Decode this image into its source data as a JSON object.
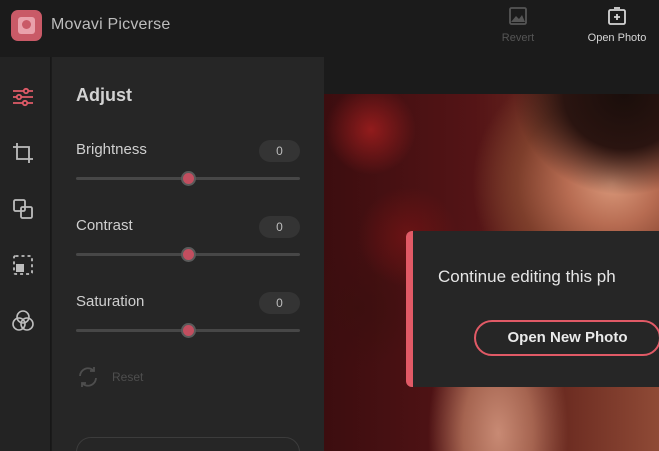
{
  "app": {
    "title": "Movavi Picverse"
  },
  "toolbar": {
    "revert_label": "Revert",
    "open_photo_label": "Open Photo"
  },
  "sidebar": {
    "tools": [
      {
        "name": "adjust",
        "icon": "sliders-icon",
        "active": true
      },
      {
        "name": "crop",
        "icon": "crop-icon",
        "active": false
      },
      {
        "name": "layers",
        "icon": "layers-icon",
        "active": false
      },
      {
        "name": "select",
        "icon": "selection-icon",
        "active": false
      },
      {
        "name": "color",
        "icon": "color-circles-icon",
        "active": false
      }
    ]
  },
  "panel": {
    "title": "Adjust",
    "controls": [
      {
        "label": "Brightness",
        "value": "0",
        "level": 0.5
      },
      {
        "label": "Contrast",
        "value": "0",
        "level": 0.5
      },
      {
        "label": "Saturation",
        "value": "0",
        "level": 0.5
      }
    ],
    "reset_label": "Reset"
  },
  "dialog": {
    "message": "Continue editing this ph",
    "button_label": "Open New Photo"
  },
  "colors": {
    "accent": "#e15a66",
    "active_icon": "#e05b68",
    "background": "#1b1b1b",
    "panel": "#262626"
  }
}
